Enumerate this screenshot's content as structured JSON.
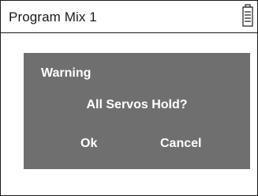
{
  "header": {
    "title": "Program Mix 1",
    "battery_icon": "battery-icon"
  },
  "dialog": {
    "title": "Warning",
    "message": "All Servos Hold?",
    "ok_label": "Ok",
    "cancel_label": "Cancel"
  },
  "colors": {
    "dialog_background": "#6f6f6f",
    "dialog_text": "#ffffff",
    "border": "#1a1a1a"
  }
}
